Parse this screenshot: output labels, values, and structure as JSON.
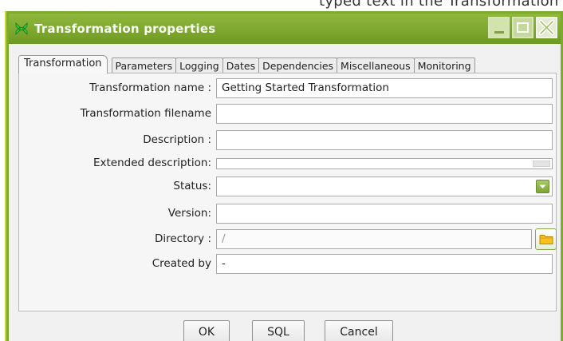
{
  "background": {
    "text_fragment": "typed text in the Transformation name field, and then click the Trans"
  },
  "window": {
    "title": "Transformation properties",
    "controls": {
      "minimize": "minimize",
      "maximize": "maximize",
      "close": "close"
    }
  },
  "tabs": [
    {
      "label": "Transformation",
      "active": true
    },
    {
      "label": "Parameters",
      "active": false
    },
    {
      "label": "Logging",
      "active": false
    },
    {
      "label": "Dates",
      "active": false
    },
    {
      "label": "Dependencies",
      "active": false
    },
    {
      "label": "Miscellaneous",
      "active": false
    },
    {
      "label": "Monitoring",
      "active": false
    }
  ],
  "form": {
    "transformation_name": {
      "label": "Transformation name :",
      "value": "Getting Started Transformation"
    },
    "transformation_filename": {
      "label": "Transformation filename",
      "value": ""
    },
    "description": {
      "label": "Description :",
      "value": ""
    },
    "extended_description": {
      "label": "Extended description:",
      "value": ""
    },
    "status": {
      "label": "Status:",
      "value": ""
    },
    "version": {
      "label": "Version:",
      "value": ""
    },
    "directory": {
      "label": "Directory :",
      "value": "/"
    },
    "created_by": {
      "label": "Created by",
      "value": "-"
    }
  },
  "buttons": {
    "ok": "OK",
    "sql": "SQL",
    "cancel": "Cancel"
  },
  "colors": {
    "window_frame": "#7fab2d",
    "title_text": "#ffffff",
    "client_bg": "#f1f1f1",
    "highlight_bar": "#f5ea00"
  }
}
